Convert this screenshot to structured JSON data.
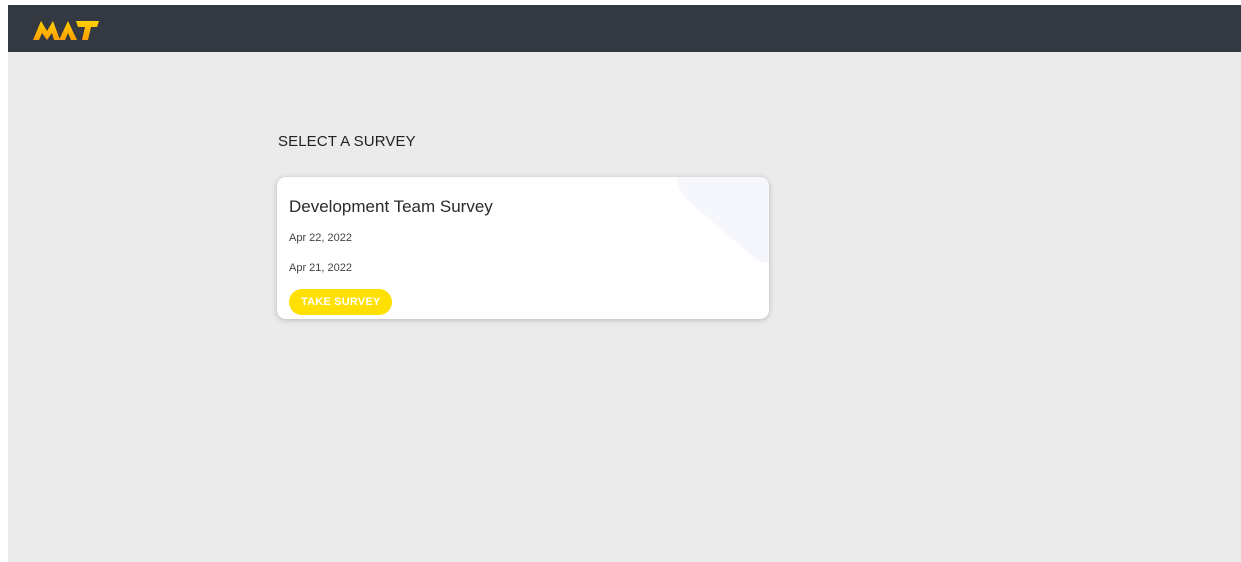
{
  "header": {
    "logo_text": "MAT",
    "logo_icon": "mat-logo-icon",
    "background_color": "#343840",
    "logo_colors": [
      "#ffd000",
      "#ff9f00"
    ]
  },
  "main": {
    "page_title": "SELECT A SURVEY",
    "surveys": [
      {
        "title": "Development Team Survey",
        "date_1": "Apr 22, 2022",
        "date_2": "Apr 21, 2022",
        "action_label": "TAKE SURVEY"
      }
    ]
  },
  "colors": {
    "page_background": "#ebebeb",
    "card_background": "#ffffff",
    "button_background": "#ffe000",
    "button_text": "#ffffff"
  }
}
